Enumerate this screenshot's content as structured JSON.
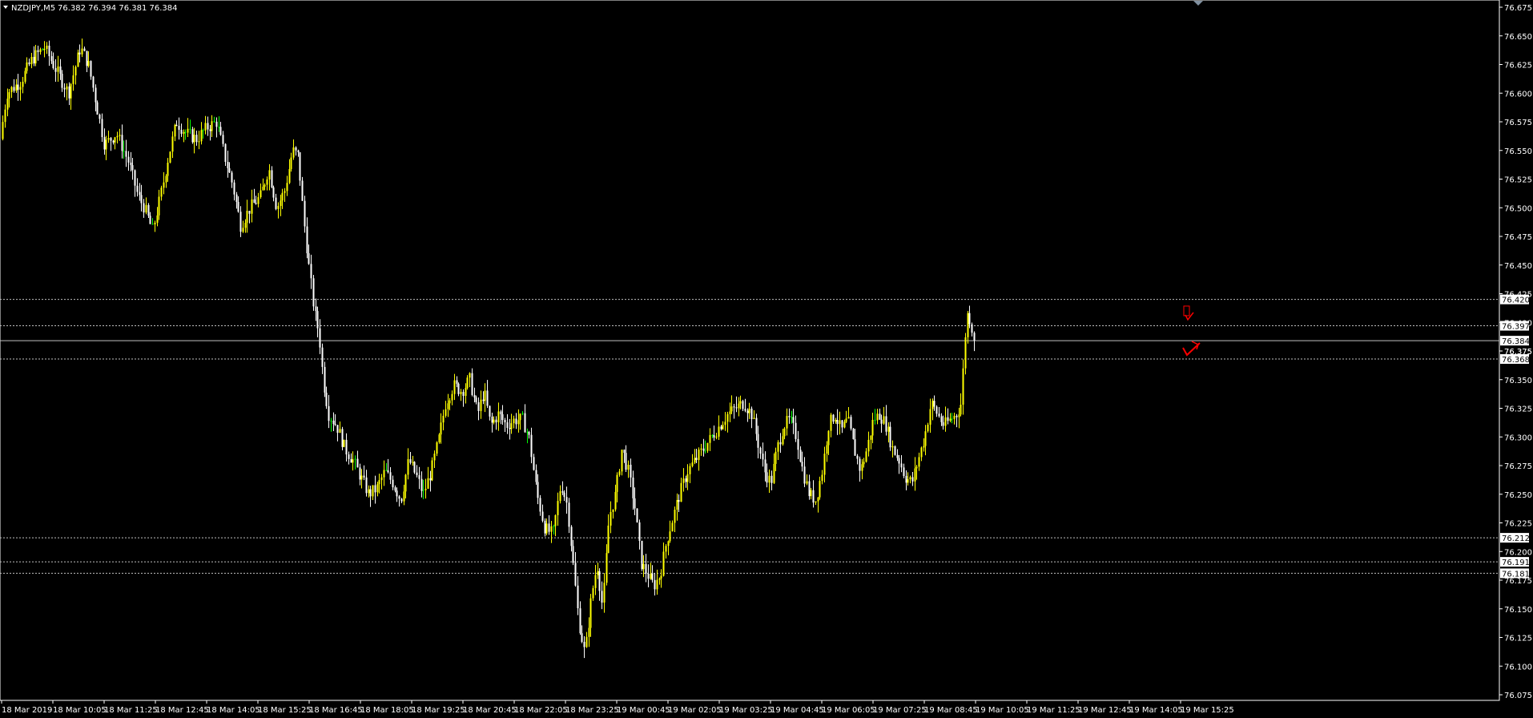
{
  "header": {
    "symbol_timeframe": "NZDJPY,M5",
    "ohlc": "76.382 76.394 76.381 76.384"
  },
  "colors": {
    "background": "#000000",
    "bull_candle": "#ffff00",
    "bear_candle": "#ffffff",
    "doji_candle": "#00ff00",
    "grid_line": "#c0c0c0",
    "bid_line": "#c0c0c0",
    "arrow_marker": "#ff0000"
  },
  "chart_data": {
    "type": "candlestick",
    "symbol": "NZDJPY",
    "timeframe": "M5",
    "ylim": [
      76.075,
      76.675
    ],
    "y_ticks": [
      "76.675",
      "76.650",
      "76.625",
      "76.600",
      "76.575",
      "76.550",
      "76.525",
      "76.500",
      "76.475",
      "76.450",
      "76.425",
      "76.400",
      "76.375",
      "76.350",
      "76.325",
      "76.300",
      "76.275",
      "76.250",
      "76.225",
      "76.200",
      "76.175",
      "76.150",
      "76.125",
      "76.100",
      "76.075"
    ],
    "x_ticks": [
      "18 Mar 2019",
      "18 Mar 10:05",
      "18 Mar 11:25",
      "18 Mar 12:45",
      "18 Mar 14:05",
      "18 Mar 15:25",
      "18 Mar 16:45",
      "18 Mar 18:05",
      "18 Mar 19:25",
      "18 Mar 20:45",
      "18 Mar 22:05",
      "18 Mar 23:25",
      "19 Mar 00:45",
      "19 Mar 02:05",
      "19 Mar 03:25",
      "19 Mar 04:45",
      "19 Mar 06:05",
      "19 Mar 07:25",
      "19 Mar 08:45",
      "19 Mar 10:05",
      "19 Mar 11:25",
      "19 Mar 12:45",
      "19 Mar 14:05",
      "19 Mar 15:25"
    ],
    "price_path": [
      [
        0,
        76.56
      ],
      [
        8,
        76.6
      ],
      [
        25,
        76.61
      ],
      [
        40,
        76.63
      ],
      [
        55,
        76.64
      ],
      [
        70,
        76.62
      ],
      [
        85,
        76.6
      ],
      [
        100,
        76.64
      ],
      [
        110,
        76.625
      ],
      [
        120,
        76.59
      ],
      [
        130,
        76.555
      ],
      [
        145,
        76.565
      ],
      [
        160,
        76.54
      ],
      [
        172,
        76.51
      ],
      [
        180,
        76.5
      ],
      [
        190,
        76.48
      ],
      [
        200,
        76.51
      ],
      [
        210,
        76.545
      ],
      [
        220,
        76.575
      ],
      [
        232,
        76.565
      ],
      [
        245,
        76.56
      ],
      [
        258,
        76.57
      ],
      [
        270,
        76.575
      ],
      [
        280,
        76.545
      ],
      [
        290,
        76.52
      ],
      [
        300,
        76.485
      ],
      [
        312,
        76.5
      ],
      [
        325,
        76.51
      ],
      [
        335,
        76.535
      ],
      [
        345,
        76.5
      ],
      [
        355,
        76.515
      ],
      [
        365,
        76.55
      ],
      [
        372,
        76.545
      ],
      [
        378,
        76.495
      ],
      [
        385,
        76.45
      ],
      [
        392,
        76.41
      ],
      [
        398,
        76.39
      ],
      [
        403,
        76.35
      ],
      [
        410,
        76.32
      ],
      [
        420,
        76.31
      ],
      [
        430,
        76.29
      ],
      [
        440,
        76.28
      ],
      [
        450,
        76.265
      ],
      [
        460,
        76.25
      ],
      [
        470,
        76.255
      ],
      [
        480,
        76.27
      ],
      [
        490,
        76.26
      ],
      [
        500,
        76.245
      ],
      [
        510,
        76.28
      ],
      [
        520,
        76.265
      ],
      [
        528,
        76.25
      ],
      [
        538,
        76.27
      ],
      [
        548,
        76.3
      ],
      [
        556,
        76.33
      ],
      [
        566,
        76.345
      ],
      [
        576,
        76.34
      ],
      [
        586,
        76.35
      ],
      [
        596,
        76.32
      ],
      [
        604,
        76.34
      ],
      [
        612,
        76.31
      ],
      [
        622,
        76.32
      ],
      [
        632,
        76.31
      ],
      [
        642,
        76.315
      ],
      [
        652,
        76.315
      ],
      [
        660,
        76.3
      ],
      [
        670,
        76.25
      ],
      [
        680,
        76.22
      ],
      [
        690,
        76.215
      ],
      [
        700,
        76.26
      ],
      [
        708,
        76.24
      ],
      [
        715,
        76.19
      ],
      [
        722,
        76.14
      ],
      [
        730,
        76.11
      ],
      [
        738,
        76.16
      ],
      [
        745,
        76.19
      ],
      [
        752,
        76.15
      ],
      [
        760,
        76.23
      ],
      [
        768,
        76.25
      ],
      [
        776,
        76.29
      ],
      [
        784,
        76.27
      ],
      [
        792,
        76.24
      ],
      [
        800,
        76.19
      ],
      [
        808,
        76.18
      ],
      [
        816,
        76.17
      ],
      [
        824,
        76.18
      ],
      [
        832,
        76.21
      ],
      [
        840,
        76.23
      ],
      [
        848,
        76.25
      ],
      [
        858,
        76.27
      ],
      [
        868,
        76.28
      ],
      [
        878,
        76.29
      ],
      [
        888,
        76.3
      ],
      [
        898,
        76.31
      ],
      [
        908,
        76.32
      ],
      [
        918,
        76.325
      ],
      [
        928,
        76.33
      ],
      [
        938,
        76.32
      ],
      [
        946,
        76.295
      ],
      [
        954,
        76.27
      ],
      [
        962,
        76.26
      ],
      [
        970,
        76.29
      ],
      [
        978,
        76.31
      ],
      [
        986,
        76.315
      ],
      [
        994,
        76.3
      ],
      [
        1002,
        76.27
      ],
      [
        1010,
        76.25
      ],
      [
        1018,
        76.245
      ],
      [
        1026,
        76.27
      ],
      [
        1034,
        76.31
      ],
      [
        1042,
        76.32
      ],
      [
        1050,
        76.305
      ],
      [
        1058,
        76.315
      ],
      [
        1066,
        76.29
      ],
      [
        1074,
        76.27
      ],
      [
        1082,
        76.29
      ],
      [
        1090,
        76.315
      ],
      [
        1098,
        76.32
      ],
      [
        1106,
        76.31
      ],
      [
        1114,
        76.29
      ],
      [
        1122,
        76.28
      ],
      [
        1130,
        76.265
      ],
      [
        1138,
        76.26
      ],
      [
        1146,
        76.28
      ],
      [
        1154,
        76.3
      ],
      [
        1162,
        76.33
      ],
      [
        1170,
        76.32
      ],
      [
        1178,
        76.31
      ],
      [
        1186,
        76.315
      ],
      [
        1194,
        76.32
      ],
      [
        1200,
        76.33
      ],
      [
        1204,
        76.385
      ],
      [
        1208,
        76.41
      ],
      [
        1213,
        76.395
      ],
      [
        1217,
        76.384
      ]
    ],
    "price_path_note_hidden": true,
    "levels": [
      {
        "price": 76.42,
        "label": "76.420",
        "style": "dashed"
      },
      {
        "price": 76.397,
        "label": "76.397",
        "style": "dashed"
      },
      {
        "price": 76.384,
        "label": "76.384",
        "style": "solid"
      },
      {
        "price": 76.375,
        "label": "76.375",
        "style": "tick"
      },
      {
        "price": 76.368,
        "label": "76.368",
        "style": "dashed"
      },
      {
        "price": 76.212,
        "label": "76.212",
        "style": "dashed"
      },
      {
        "price": 76.191,
        "label": "76.191",
        "style": "dashed"
      },
      {
        "price": 76.181,
        "label": "76.181",
        "style": "dashed"
      }
    ]
  }
}
